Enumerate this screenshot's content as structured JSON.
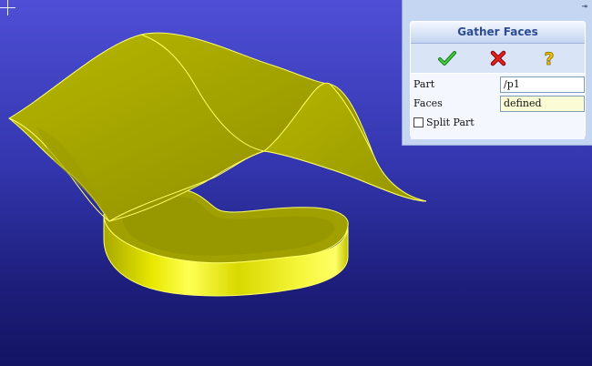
{
  "dialog": {
    "title": "Gather Faces",
    "fields": {
      "part_label": "Part",
      "part_value": "/p1",
      "faces_label": "Faces",
      "faces_value": "defined"
    },
    "split_part_label": "Split Part",
    "split_part_checked": false
  },
  "icons": {
    "ok": "checkmark-icon",
    "cancel": "x-icon",
    "help": "question-icon",
    "pin": "pin-icon",
    "cursor": "crosshair-icon"
  },
  "colors": {
    "surface": "#a8a800",
    "surface_highlight": "#ffff3c",
    "edge": "#ffff66",
    "background_top": "#4e4fd6",
    "background_bottom": "#131463",
    "dialog_title": "#2b4c95"
  }
}
